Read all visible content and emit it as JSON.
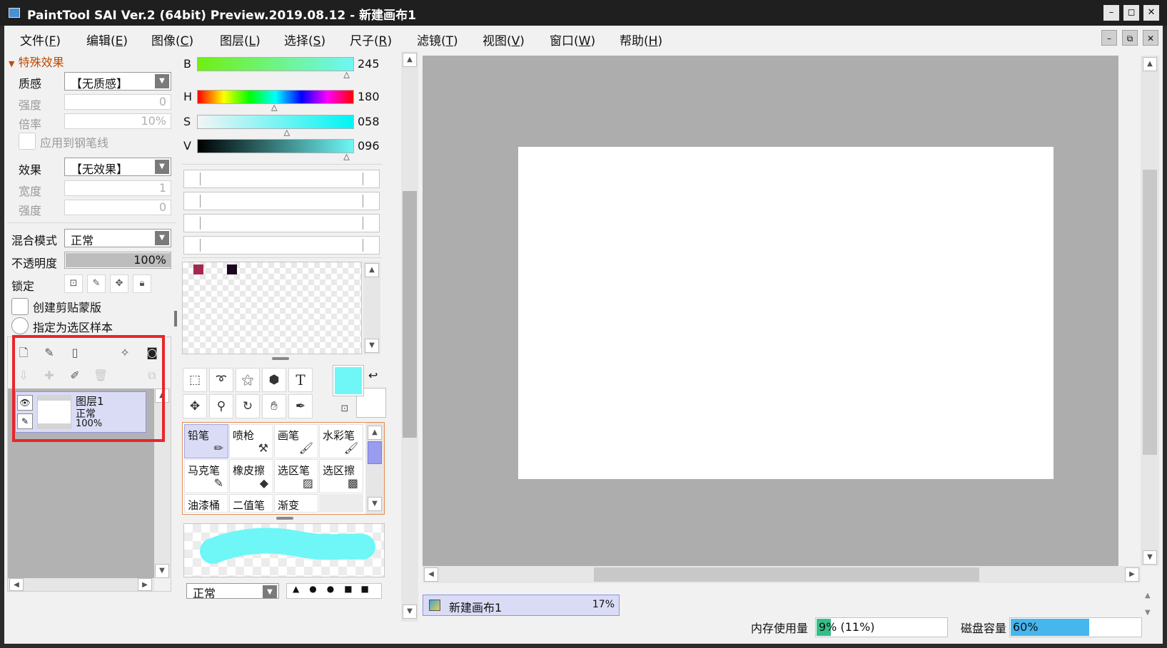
{
  "window": {
    "title": "PaintTool SAI Ver.2 (64bit) Preview.2019.08.12 - 新建画布1",
    "minimize": "–",
    "maximize": "◻",
    "close": "✕"
  },
  "menu": {
    "items": [
      {
        "label": "文件(",
        "key": "F",
        "end": ")"
      },
      {
        "label": "编辑(",
        "key": "E",
        "end": ")"
      },
      {
        "label": "图像(",
        "key": "C",
        "end": ")"
      },
      {
        "label": "图层(",
        "key": "L",
        "end": ")"
      },
      {
        "label": "选择(",
        "key": "S",
        "end": ")"
      },
      {
        "label": "尺子(",
        "key": "R",
        "end": ")"
      },
      {
        "label": "滤镜(",
        "key": "T",
        "end": ")"
      },
      {
        "label": "视图(",
        "key": "V",
        "end": ")"
      },
      {
        "label": "窗口(",
        "key": "W",
        "end": ")"
      },
      {
        "label": "帮助(",
        "key": "H",
        "end": ")"
      }
    ],
    "mdi_minimize": "–",
    "mdi_restore": "⧉",
    "mdi_close": "✕"
  },
  "effects": {
    "header": "特殊效果",
    "texture_label": "质感",
    "texture_value": "【无质感】",
    "texture_strength_label": "强度",
    "texture_strength_value": "0",
    "texture_scale_label": "倍率",
    "texture_scale_value": "10%",
    "apply_pen_label": "应用到钢笔线",
    "effect_label": "效果",
    "effect_value": "【无效果】",
    "effect_width_label": "宽度",
    "effect_width_value": "1",
    "effect_strength_label": "强度",
    "effect_strength_value": "0"
  },
  "layer_props": {
    "blend_label": "混合模式",
    "blend_value": "正常",
    "opacity_label": "不透明度",
    "opacity_value": "100%",
    "opacity": 1.0,
    "lock_label": "锁定",
    "clip_label": "创建剪贴蒙版",
    "selection_source_label": "指定为选区样本"
  },
  "layers": [
    {
      "name": "图层1",
      "mode": "正常",
      "opacity": "100%"
    }
  ],
  "color": {
    "b_label": "B",
    "b_value": "245",
    "b": 245,
    "h_label": "H",
    "h_value": "180",
    "h": 180,
    "s_label": "S",
    "s_value": "058",
    "s": 58,
    "v_label": "V",
    "v_value": "096",
    "v": 96,
    "swatch_1": "#a3294f",
    "swatch_2": "#1c0620",
    "primary": "#6ff6f6",
    "secondary": "#ffffff"
  },
  "tools": {
    "text_tool": "T"
  },
  "brushes": [
    {
      "name": "铅笔",
      "selected": true
    },
    {
      "name": "喷枪",
      "selected": false
    },
    {
      "name": "画笔",
      "selected": false
    },
    {
      "name": "水彩笔",
      "selected": false
    },
    {
      "name": "马克笔",
      "selected": false
    },
    {
      "name": "橡皮擦",
      "selected": false
    },
    {
      "name": "选区笔",
      "selected": false
    },
    {
      "name": "选区擦",
      "selected": false
    },
    {
      "name": "油漆桶",
      "selected": false
    },
    {
      "name": "二值笔",
      "selected": false
    },
    {
      "name": "渐变",
      "selected": false
    }
  ],
  "brush_mode_value": "正常",
  "canvas_tab": {
    "name": "新建画布1",
    "zoom": "17%"
  },
  "status": {
    "memory_label": "内存使用量",
    "memory_value": "9% (11%)",
    "memory_fraction": 0.09,
    "disk_label": "磁盘容量",
    "disk_value": "60%",
    "disk_fraction": 0.6
  }
}
